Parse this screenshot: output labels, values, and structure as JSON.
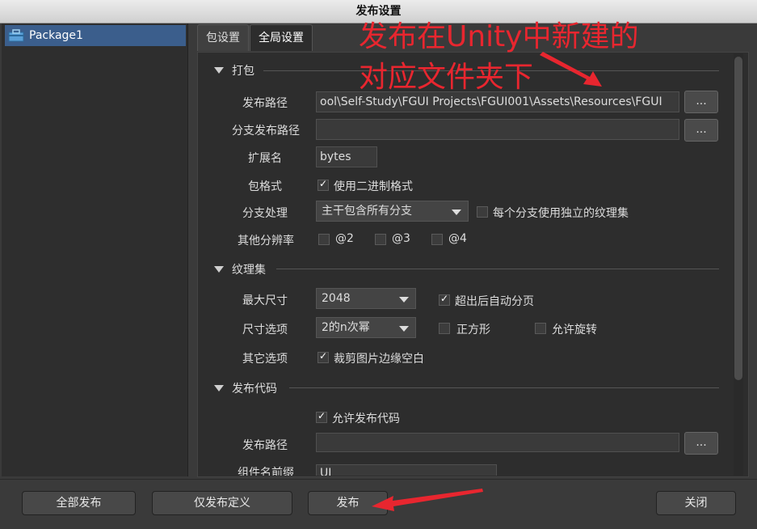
{
  "window": {
    "title": "发布设置"
  },
  "sidebar": {
    "items": [
      {
        "label": "Package1",
        "icon": "package-icon"
      }
    ]
  },
  "tabs": [
    {
      "label": "包设置"
    },
    {
      "label": "全局设置"
    }
  ],
  "sections": {
    "pack": {
      "title": "打包",
      "publish_path_label": "发布路径",
      "publish_path_value": "ool\\Self-Study\\FGUI Projects\\FGUI001\\Assets\\Resources\\FGUI",
      "branch_path_label": "分支发布路径",
      "branch_path_value": "",
      "extension_label": "扩展名",
      "extension_value": "bytes",
      "format_label": "包格式",
      "binary_label": "使用二进制格式",
      "branch_label": "分支处理",
      "branch_option": "主干包含所有分支",
      "branch_atlas_label": "每个分支使用独立的纹理集",
      "resolution_label": "其他分辨率",
      "res_2": "@2",
      "res_3": "@3",
      "res_4": "@4"
    },
    "atlas": {
      "title": "纹理集",
      "max_size_label": "最大尺寸",
      "max_size_value": "2048",
      "auto_page_label": "超出后自动分页",
      "size_option_label": "尺寸选项",
      "size_option_value": "2的n次幂",
      "square_label": "正方形",
      "rotate_label": "允许旋转",
      "other_label": "其它选项",
      "trim_label": "裁剪图片边缘空白"
    },
    "code": {
      "title": "发布代码",
      "allow_label": "允许发布代码",
      "path_label": "发布路径",
      "path_value": "",
      "prefix_label": "组件名前缀",
      "prefix_value": "UI"
    }
  },
  "buttons": {
    "dots": "...",
    "publish_all": "全部发布",
    "publish_def": "仅发布定义",
    "publish": "发布",
    "close": "关闭"
  },
  "annotation": {
    "line1": "发布在Unity中新建的",
    "line2": "对应文件夹下"
  },
  "colors": {
    "accent": "#3b5e8c",
    "annotation": "#e8262f"
  }
}
